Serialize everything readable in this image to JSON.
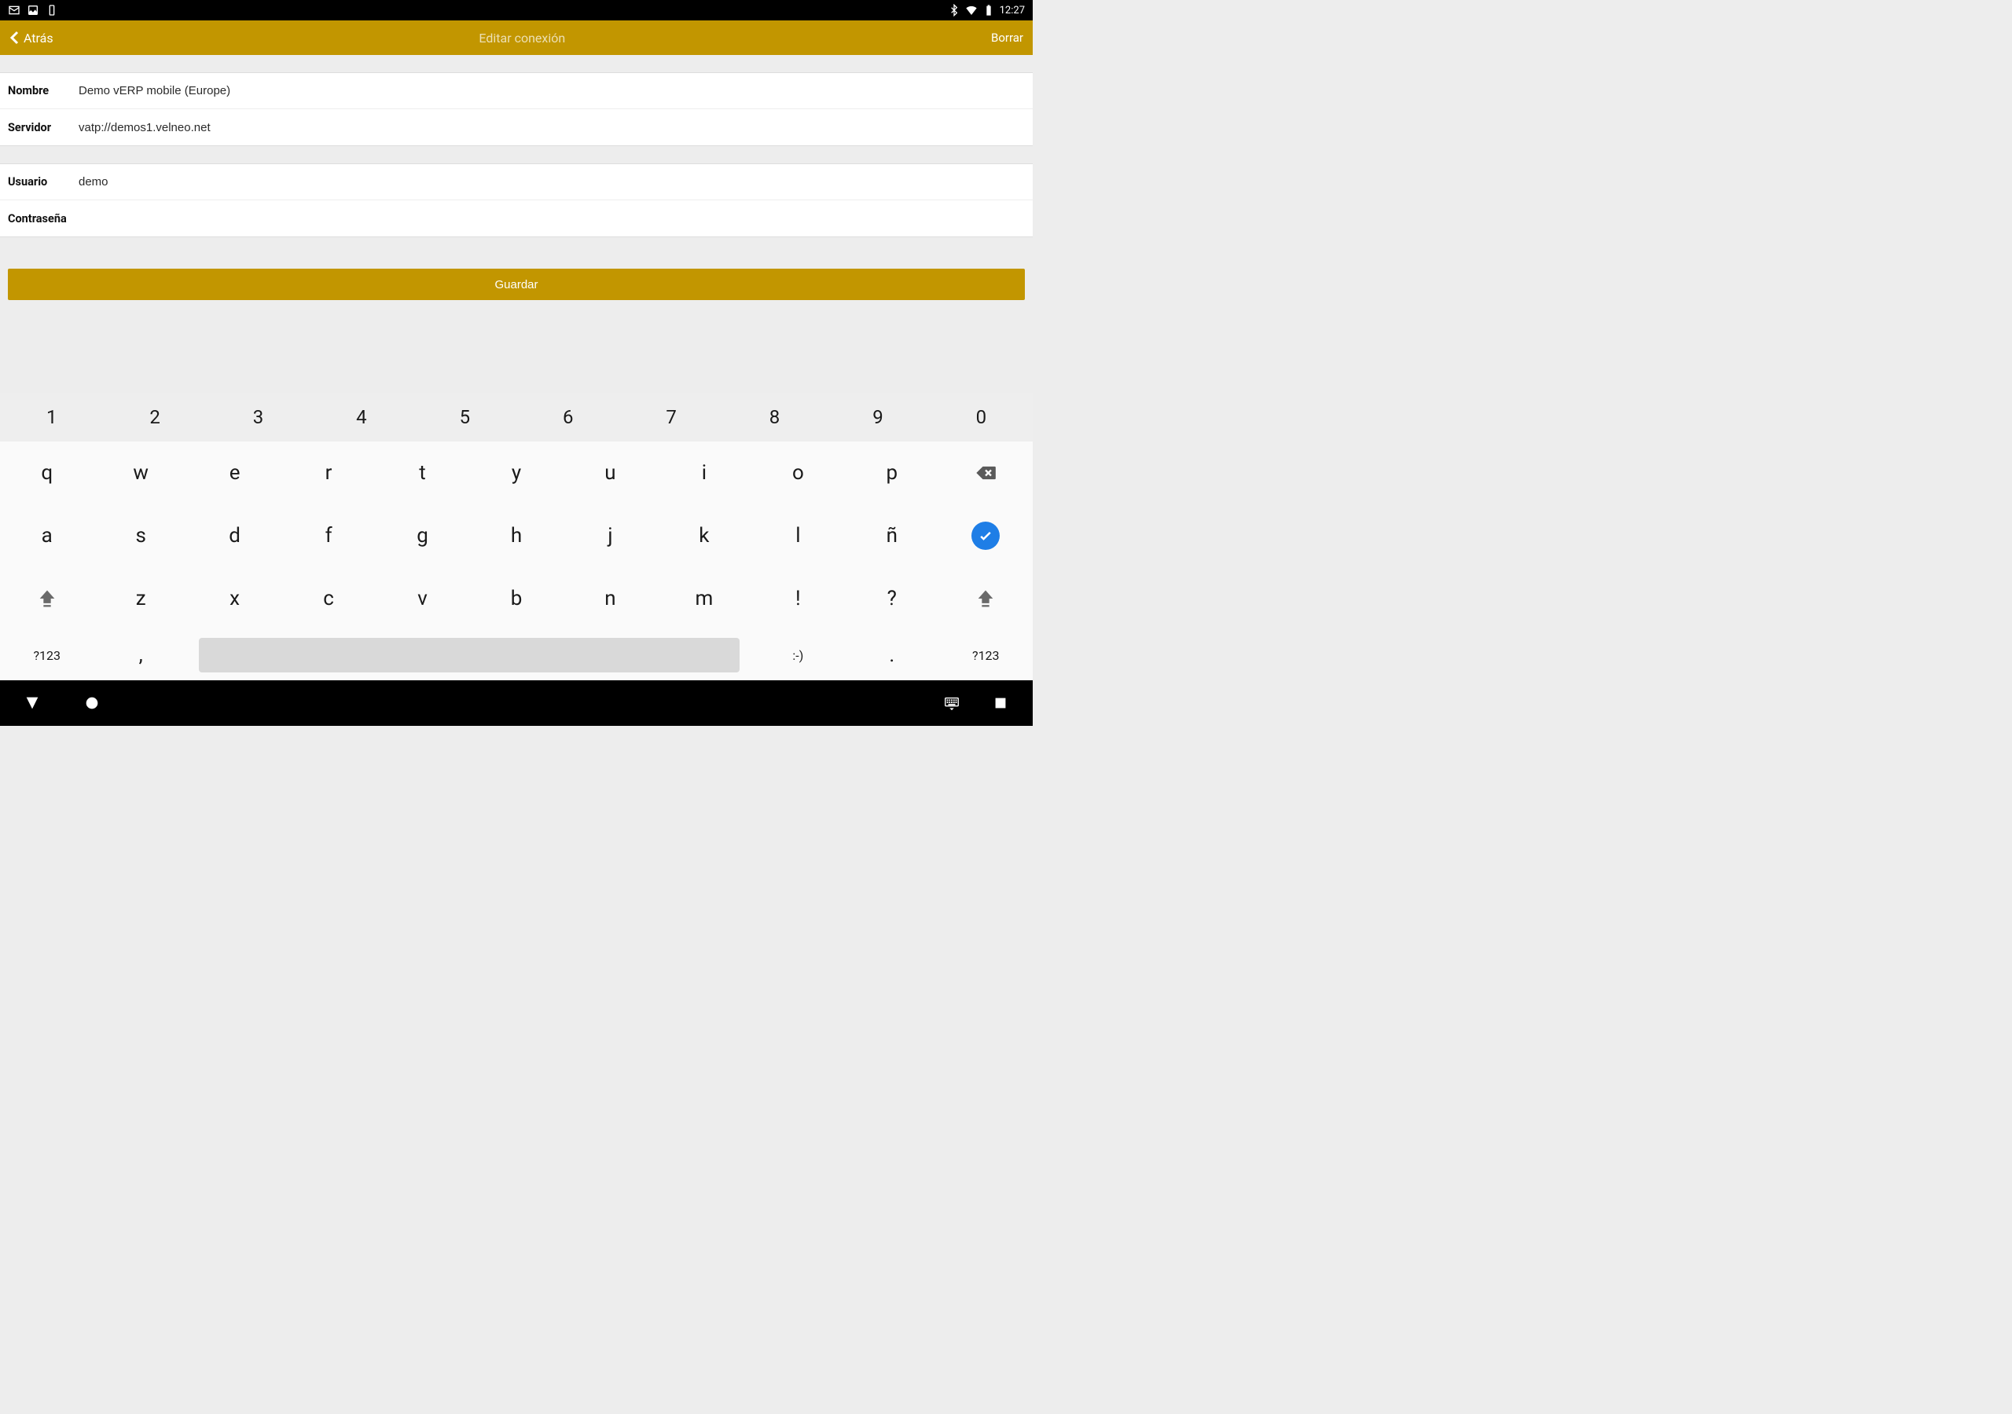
{
  "statusbar": {
    "time": "12:27"
  },
  "appbar": {
    "back": "Atrás",
    "title": "Editar conexión",
    "delete": "Borrar"
  },
  "form": {
    "name_label": "Nombre",
    "name_value": "Demo vERP mobile (Europe)",
    "server_label": "Servidor",
    "server_value": "vatp://demos1.velneo.net",
    "user_label": "Usuario",
    "user_value": "demo",
    "pass_label": "Contraseña",
    "pass_value": ""
  },
  "save_label": "Guardar",
  "keyboard": {
    "row_num": [
      "1",
      "2",
      "3",
      "4",
      "5",
      "6",
      "7",
      "8",
      "9",
      "0"
    ],
    "row1": [
      "q",
      "w",
      "e",
      "r",
      "t",
      "y",
      "u",
      "i",
      "o",
      "p"
    ],
    "row2": [
      "a",
      "s",
      "d",
      "f",
      "g",
      "h",
      "j",
      "k",
      "l",
      "ñ"
    ],
    "row3": [
      "z",
      "x",
      "c",
      "v",
      "b",
      "n",
      "m",
      "!",
      "?"
    ],
    "sym": "?123",
    "comma": ",",
    "emoji": ":-)",
    "dot": "."
  }
}
